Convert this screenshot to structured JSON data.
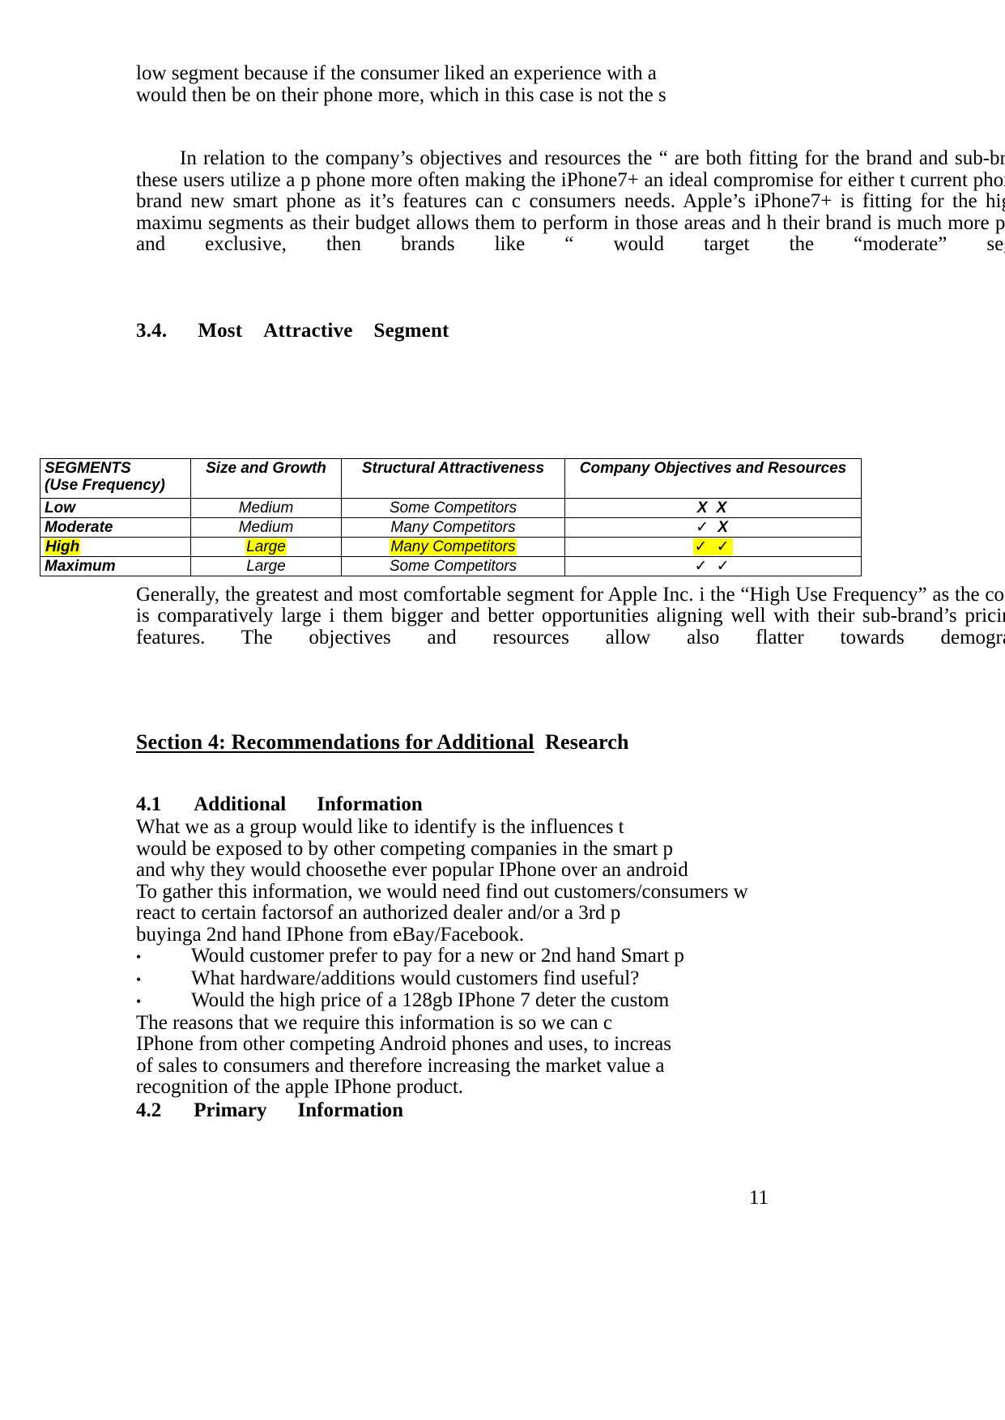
{
  "document": {
    "page_number": "11"
  },
  "paragraphs": {
    "p1_line1": "low segment because if the consumer liked an experience with a",
    "p1_line2": "would then be on their phone more, which in this case is not the s",
    "p2": "In relation to the company’s objectives and resources the “ are both fitting for the brand and sub-brand as these users utilize a p phone more often making the iPhone7+ an ideal compromise for either t current phone or a brand new smart phone as it’s features can c consumers needs. Apple’s iPhone7+ is fitting for the high and maximu segments as their budget allows them to perform in those areas and h their brand is much more prestige and exclusive, then brands like “ would target the “moderate” segment.",
    "p3": "Generally, the greatest and most comfortable segment for Apple Inc. i the “High Use Frequency” as the company is comparatively large i them bigger and better opportunities aligning well with their sub-brand’s pricing and features. The objectives and resources allow also flatter towards demographics."
  },
  "headings": {
    "h3_4_number": "3.4.",
    "h3_4_word1": "Most",
    "h3_4_word2": "Attractive",
    "h3_4_word3": "Segment",
    "section4_underlined": "Section 4: Recommendations for Additional",
    "section4_tail": "Research",
    "h4_1_number": "4.1",
    "h4_1_word1": "Additional",
    "h4_1_word2": "Information",
    "h4_2_number": "4.2",
    "h4_2_word1": "Primary",
    "h4_2_word2": "Information"
  },
  "table": {
    "headers": [
      "SEGMENTS\n(Use Frequency)",
      "Size and Growth",
      "Structural Attractiveness",
      "Company Objectives and Resources"
    ],
    "header_col1_line1": "SEGMENTS",
    "header_col1_line2": "(Use Frequency)",
    "header_col2": "Size and Growth",
    "header_col3": "Structural Attractiveness",
    "header_col4": "Company Objectives and Resources",
    "highlight_color": "#ffff00",
    "rows": [
      {
        "segment": "Low",
        "size_and_growth": "Medium",
        "structural_attractiveness": "Some Competitors",
        "company_objectives_and_resources": "X X",
        "highlighted": false
      },
      {
        "segment": "Moderate",
        "size_and_growth": "Medium",
        "structural_attractiveness": "Many Competitors",
        "company_objectives_and_resources": "✓ X",
        "highlighted": false
      },
      {
        "segment": "High",
        "size_and_growth": "Large",
        "structural_attractiveness": "Many Competitors",
        "company_objectives_and_resources": "✓ ✓",
        "highlighted": true
      },
      {
        "segment": "Maximum",
        "size_and_growth": "Large",
        "structural_attractiveness": "Some Competitors",
        "company_objectives_and_resources": "✓ ✓",
        "highlighted": false
      }
    ]
  },
  "section4_body": {
    "line1": "What we as a group would like to identify is the influences t",
    "line2": "would be exposed to by other competing companies in the smart p",
    "line3": "and why they would choosethe ever popular IPhone over an android",
    "line4": "To gather this information, we would need find out customers/consumers w",
    "line5": "react to certain factorsof an authorized dealer and/or a 3rd p",
    "line6": "buyinga 2nd hand IPhone from eBay/Facebook.",
    "bullets": [
      "Would customer prefer to pay for a new or 2nd hand Smart p",
      "What hardware/additions would customers find useful?",
      "Would the high price of a 128gb IPhone 7 deter the custom"
    ],
    "bullet_glyph": "•",
    "tail1": "The reasons that we require this information is so we can c",
    "tail2": "IPhone from other competing Android phones and uses, to increas",
    "tail3": "of sales to consumers and therefore increasing the market value a",
    "tail4": "recognition of the apple IPhone product."
  }
}
